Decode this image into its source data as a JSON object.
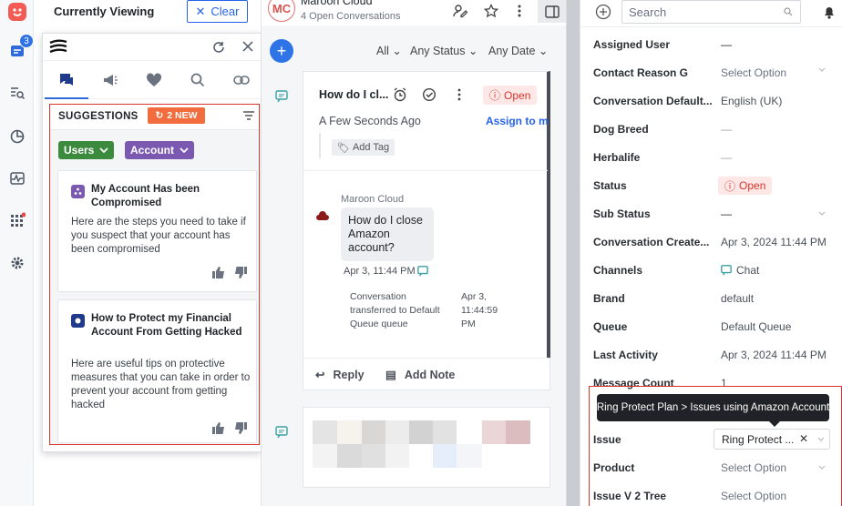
{
  "list_header": {
    "title": "Currently Viewing",
    "clear_label": "Clear"
  },
  "rail": {
    "notification_count": "3"
  },
  "suggestions": {
    "title": "SUGGESTIONS",
    "new_badge": "2 NEW",
    "chips": [
      "Users",
      "Account"
    ],
    "cards": [
      {
        "title": "My Account Has been Compromised",
        "body": "Here are the steps  you need to take if you suspect that your account has been compromised"
      },
      {
        "title": "How to Protect my Financial Account From Getting Hacked",
        "body": "Here are useful tips on protective measures that you can take in order to prevent your account from getting hacked"
      }
    ]
  },
  "conversation": {
    "avatar_initials": "MC",
    "contact_name": "Maroon Cloud",
    "open_conversations": "4 Open Conversations",
    "filters": [
      "All",
      "Any Status",
      "Any Date"
    ],
    "subject": "How do I cl...",
    "status": "Open",
    "time_ago": "A Few Seconds Ago",
    "assign_label": "Assign to me",
    "add_tag": "Add Tag",
    "message_sender": "Maroon Cloud",
    "message_text": "How do I close Amazon account?",
    "message_time": "Apr 3, 11:44 PM",
    "transfer_note": "Conversation transferred to Default Queue queue",
    "transfer_time": "Apr 3, 11:44:59 PM",
    "reply_label": "Reply",
    "add_note_label": "Add Note"
  },
  "right_panel": {
    "search_placeholder": "Search",
    "properties": [
      {
        "label": "Assigned User",
        "value": "—"
      },
      {
        "label": "Contact Reason G",
        "value": "Select Option"
      },
      {
        "label": "Conversation Default...",
        "value": "English (UK)"
      },
      {
        "label": "Dog Breed",
        "value": "—"
      },
      {
        "label": "Herbalife",
        "value": "—"
      },
      {
        "label": "Status",
        "value": "Open"
      },
      {
        "label": "Sub Status",
        "value": "—"
      },
      {
        "label": "Conversation Create...",
        "value": "Apr 3, 2024 11:44 PM"
      },
      {
        "label": "Channels",
        "value": "Chat"
      },
      {
        "label": "Brand",
        "value": "default"
      },
      {
        "label": "Queue",
        "value": "Default Queue"
      },
      {
        "label": "Last Activity",
        "value": "Apr 3, 2024 11:44 PM"
      },
      {
        "label": "Message Count",
        "value": "1"
      },
      {
        "label": "Issue",
        "value": "Ring Protect ..."
      },
      {
        "label": "Product",
        "value": "Select Option"
      },
      {
        "label": "Issue V 2 Tree",
        "value": "Select Option"
      }
    ],
    "tooltip": "Ring Protect Plan > Issues using Amazon Account"
  }
}
